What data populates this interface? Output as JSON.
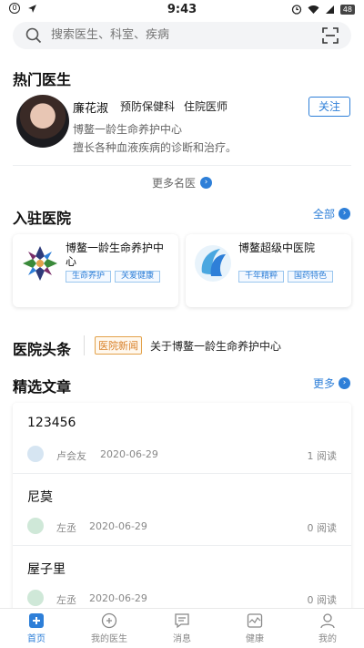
{
  "status_bar": {
    "left_badge": "0",
    "time": "9:43",
    "battery": "48"
  },
  "search": {
    "placeholder": "搜索医生、科室、疾病"
  },
  "hot_doctors": {
    "title": "热门医生",
    "doctor": {
      "name": "廉花淑",
      "department": "预防保健科",
      "title": "住院医师",
      "hospital": "博鳌一龄生命养护中心",
      "description": "擅长各种血液疾病的诊断和治疗。",
      "follow_label": "关注"
    },
    "more_label": "更多名医"
  },
  "hospitals": {
    "title": "入驻医院",
    "all_label": "全部",
    "items": [
      {
        "name": "博鳌一龄生命养护中心",
        "tags": [
          "生命养护",
          "关爱健康"
        ]
      },
      {
        "name": "博鳌超级中医院",
        "tags": [
          "千年精粹",
          "国药特色"
        ]
      }
    ]
  },
  "headlines": {
    "logo": "医院头条",
    "badge": "医院新闻",
    "text": "关于博鳌一龄生命养护中心"
  },
  "articles": {
    "title": "精选文章",
    "more_label": "更多",
    "items": [
      {
        "title": "123456",
        "author": "卢会友",
        "date": "2020-06-29",
        "reads": "1 阅读"
      },
      {
        "title": "尼莫",
        "author": "左丞",
        "date": "2020-06-29",
        "reads": "0 阅读"
      },
      {
        "title": "屋子里",
        "author": "左丞",
        "date": "2020-06-29",
        "reads": "0 阅读"
      }
    ]
  },
  "tabbar": {
    "items": [
      {
        "label": "首页",
        "icon": "home-icon",
        "active": true
      },
      {
        "label": "我的医生",
        "icon": "doctor-icon",
        "active": false
      },
      {
        "label": "消息",
        "icon": "message-icon",
        "active": false
      },
      {
        "label": "健康",
        "icon": "health-icon",
        "active": false
      },
      {
        "label": "我的",
        "icon": "profile-icon",
        "active": false
      }
    ]
  },
  "colors": {
    "accent": "#2e7fd8",
    "news_badge": "#d9822b"
  }
}
